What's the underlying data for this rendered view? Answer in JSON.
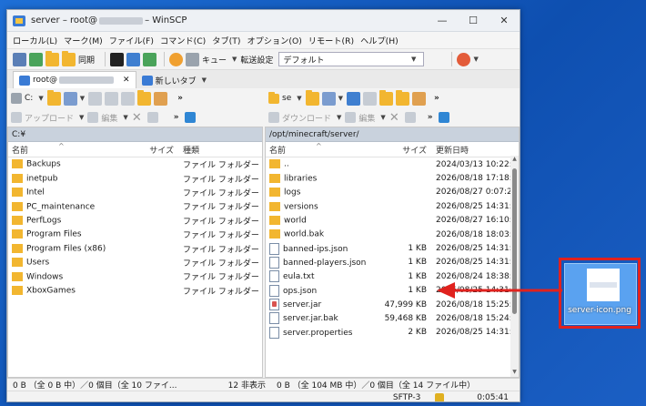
{
  "window": {
    "title_prefix": "server – root@",
    "title_suffix": " – WinSCP",
    "minimize": "—",
    "maximize": "☐",
    "close": "✕"
  },
  "menu": [
    "ローカル(L)",
    "マーク(M)",
    "ファイル(F)",
    "コマンド(C)",
    "タブ(T)",
    "オプション(O)",
    "リモート(R)",
    "ヘルプ(H)"
  ],
  "toolbar": {
    "sync_label": "同期",
    "queue_label": "キュー",
    "transfer_label": "転送設定",
    "transfer_value": "デフォルト"
  },
  "tabs": {
    "session_label": "root@",
    "session_close": "✕",
    "new_tab_label": "新しいタブ"
  },
  "left": {
    "drive": "C:",
    "upload_label": "アップロード",
    "edit_label": "編集",
    "path": "C:¥",
    "columns": {
      "name": "名前",
      "size": "サイズ",
      "type": "種類"
    },
    "sort_arrow": "^",
    "rows": [
      {
        "name": "Backups",
        "type": "ファイル フォルダー"
      },
      {
        "name": "inetpub",
        "type": "ファイル フォルダー"
      },
      {
        "name": "Intel",
        "type": "ファイル フォルダー"
      },
      {
        "name": "PC_maintenance",
        "type": "ファイル フォルダー"
      },
      {
        "name": "PerfLogs",
        "type": "ファイル フォルダー"
      },
      {
        "name": "Program Files",
        "type": "ファイル フォルダー"
      },
      {
        "name": "Program Files (x86)",
        "type": "ファイル フォルダー"
      },
      {
        "name": "Users",
        "type": "ファイル フォルダー"
      },
      {
        "name": "Windows",
        "type": "ファイル フォルダー"
      },
      {
        "name": "XboxGames",
        "type": "ファイル フォルダー"
      }
    ],
    "status": "0 B （全 0 B 中）／0 個目（全 10 ファイ...",
    "hidden": "12 非表示"
  },
  "right": {
    "drive": "se",
    "download_label": "ダウンロード",
    "edit_label": "編集",
    "path": "/opt/minecraft/server/",
    "columns": {
      "name": "名前",
      "size": "サイズ",
      "date": "更新日時"
    },
    "sort_arrow": "^",
    "rows": [
      {
        "icon": "up",
        "name": "..",
        "size": "",
        "date": "2024/03/13 10:22:5"
      },
      {
        "icon": "folder",
        "name": "libraries",
        "size": "",
        "date": "2026/08/18 17:18:4"
      },
      {
        "icon": "folder",
        "name": "logs",
        "size": "",
        "date": "2026/08/27 0:07:28"
      },
      {
        "icon": "folder",
        "name": "versions",
        "size": "",
        "date": "2026/08/25 14:31:0"
      },
      {
        "icon": "folder",
        "name": "world",
        "size": "",
        "date": "2026/08/27 16:10:2"
      },
      {
        "icon": "folder",
        "name": "world.bak",
        "size": "",
        "date": "2026/08/18 18:03:3"
      },
      {
        "icon": "file",
        "name": "banned-ips.json",
        "size": "1 KB",
        "date": "2026/08/25 14:31:0"
      },
      {
        "icon": "file",
        "name": "banned-players.json",
        "size": "1 KB",
        "date": "2026/08/25 14:31:0"
      },
      {
        "icon": "file",
        "name": "eula.txt",
        "size": "1 KB",
        "date": "2026/08/24 18:38:2"
      },
      {
        "icon": "file",
        "name": "ops.json",
        "size": "1 KB",
        "date": "2026/08/25 14:31:0"
      },
      {
        "icon": "jar",
        "name": "server.jar",
        "size": "47,999 KB",
        "date": "2026/08/18 15:25:4"
      },
      {
        "icon": "file",
        "name": "server.jar.bak",
        "size": "59,468 KB",
        "date": "2026/08/18 15:24:5"
      },
      {
        "icon": "file",
        "name": "server.properties",
        "size": "2 KB",
        "date": "2026/08/25 14:31:0"
      }
    ],
    "status": "0 B （全 104 MB 中）／0 個目（全 14 ファイル中）"
  },
  "statusbar": {
    "protocol": "SFTP-3",
    "time": "0:05:41"
  },
  "desktop_file": {
    "name": "server-icon.png"
  },
  "colors": {
    "accent": "#e0221e",
    "path_bar": "#c9d2dd",
    "folder": "#f2b630"
  }
}
